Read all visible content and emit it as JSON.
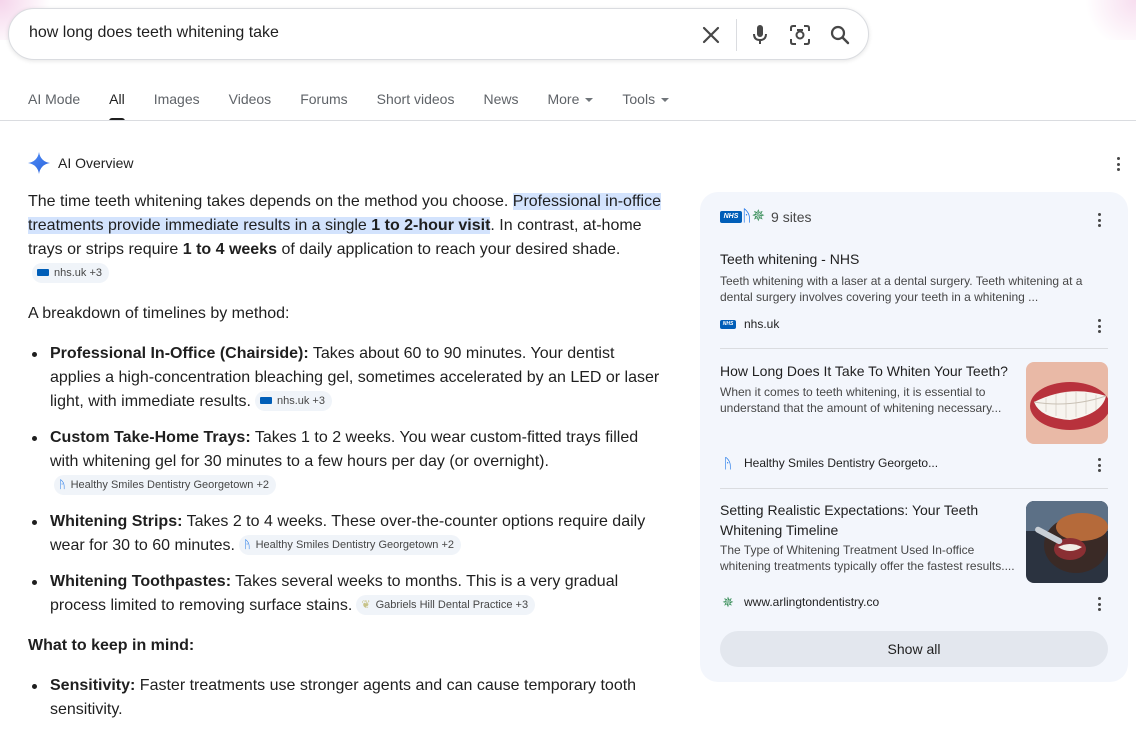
{
  "search": {
    "query": "how long does teeth whitening take",
    "clear_icon": "close-icon",
    "voice_icon": "mic-icon",
    "lens_icon": "camera-lens-icon",
    "submit_icon": "search-icon"
  },
  "tabs": [
    {
      "label": "AI Mode"
    },
    {
      "label": "All",
      "active": true
    },
    {
      "label": "Images"
    },
    {
      "label": "Videos"
    },
    {
      "label": "Forums"
    },
    {
      "label": "Short videos"
    },
    {
      "label": "News"
    },
    {
      "label": "More"
    },
    {
      "label": "Tools"
    }
  ],
  "ai_overview": {
    "title": "AI Overview",
    "intro": {
      "part1": "The time teeth whitening takes depends on the method you choose. ",
      "hl1": "Professional in-office treatments provide immediate results in a single ",
      "hl_bold": "1 to 2-hour visit",
      "part2": ". In contrast, at-home trays or strips require ",
      "bold2": "1 to 4 weeks",
      "part3": " of daily application to reach your desired shade.",
      "chip": "nhs.uk +3"
    },
    "breakdown_label": "A breakdown of timelines by method:",
    "methods": [
      {
        "name": "Professional In-Office (Chairside):",
        "text": " Takes about 60 to 90 minutes. Your dentist applies a high-concentration bleaching gel, sometimes accelerated by an LED or laser light, with immediate results.",
        "chip": "nhs.uk +3",
        "chip_icon": "nhs-logo-icon"
      },
      {
        "name": "Custom Take-Home Trays:",
        "text": " Takes 1 to 2 weeks. You wear custom-fitted trays filled with whitening gel for 30 minutes to a few hours per day (or overnight).",
        "chip": "Healthy Smiles Dentistry Georgetown +2",
        "chip_icon": "tooth-icon"
      },
      {
        "name": "Whitening Strips:",
        "text": " Takes 2 to 4 weeks. These over-the-counter options require daily wear for 30 to 60 minutes.",
        "chip": "Healthy Smiles Dentistry Georgetown +2",
        "chip_icon": "tooth-icon"
      },
      {
        "name": "Whitening Toothpastes:",
        "text": " Takes several weeks to months. This is a very gradual process limited to removing surface stains.",
        "chip": "Gabriels Hill Dental Practice +3",
        "chip_icon": "leaf-icon"
      }
    ],
    "keep_in_mind_label": "What to keep in mind:",
    "notes": [
      {
        "name": "Sensitivity:",
        "text": " Faster treatments use stronger agents and can cause temporary tooth sensitivity."
      }
    ]
  },
  "sources_panel": {
    "sites_count": "9 sites",
    "cards": [
      {
        "title": "Teeth whitening - NHS",
        "snippet": "Teeth whitening with a laser at a dental surgery. Teeth whitening at a dental surgery involves covering your teeth in a whitening ...",
        "source": "nhs.uk",
        "favicon": "nhs-logo-icon"
      },
      {
        "title": "How Long Does It Take To Whiten Your Teeth?",
        "snippet": "When it comes to teeth whitening, it is essential to understand that the amount of whitening necessary...",
        "source": "Healthy Smiles Dentistry Georgeto...",
        "favicon": "tooth-icon",
        "thumbnail": "smiling-teeth-image"
      },
      {
        "title": "Setting Realistic Expectations: Your Teeth Whitening Timeline",
        "snippet": "The Type of Whitening Treatment Used In-office whitening treatments typically offer the fastest results....",
        "source": "www.arlingtondentistry.co",
        "favicon": "star-logo-icon",
        "thumbnail": "dental-treatment-image"
      }
    ],
    "show_all_label": "Show all"
  },
  "colors": {
    "highlight": "#d3e3fd",
    "panel_bg": "#f3f6fc",
    "nhs_blue": "#005eb8",
    "gemini_blue": "#4285f4"
  }
}
